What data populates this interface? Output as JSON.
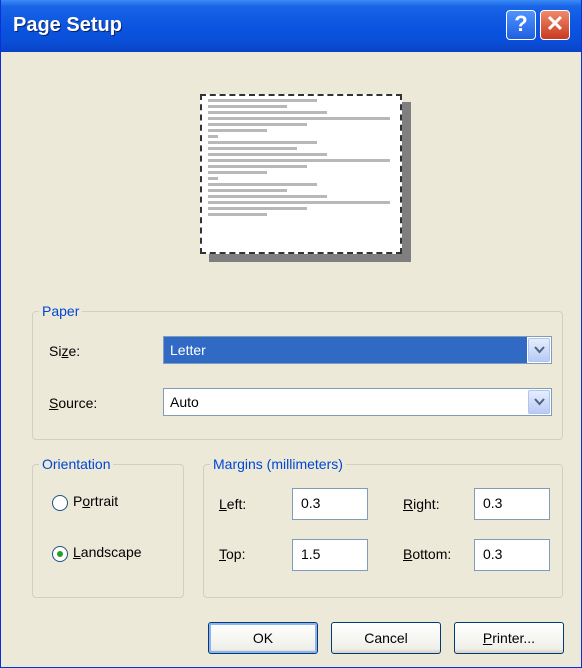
{
  "window": {
    "title": "Page Setup"
  },
  "paper": {
    "legend": "Paper",
    "size_label_pre": "Si",
    "size_label_key": "z",
    "size_label_post": "e:",
    "size_value": "Letter",
    "source_label_key": "S",
    "source_label_post": "ource:",
    "source_value": "Auto"
  },
  "orientation": {
    "legend": "Orientation",
    "portrait_pre": "P",
    "portrait_key": "o",
    "portrait_post": "rtrait",
    "landscape_key": "L",
    "landscape_post": "andscape",
    "selected": "Landscape"
  },
  "margins": {
    "legend": "Margins (millimeters)",
    "left_key": "L",
    "left_post": "eft:",
    "left_value": "0.3",
    "right_key": "R",
    "right_post": "ight:",
    "right_value": "0.3",
    "top_key": "T",
    "top_post": "op:",
    "top_value": "1.5",
    "bottom_key": "B",
    "bottom_post": "ottom:",
    "bottom_value": "0.3"
  },
  "buttons": {
    "ok": "OK",
    "cancel": "Cancel",
    "printer_key": "P",
    "printer_post": "rinter..."
  },
  "icons": {
    "help": "help-icon",
    "close": "close-icon",
    "dropdown": "chevron-down-icon"
  },
  "colors": {
    "titlebar": "#0A4ED8",
    "selection": "#316AC5",
    "group_legend": "#0046D5",
    "radio_dot": "#21A121"
  }
}
